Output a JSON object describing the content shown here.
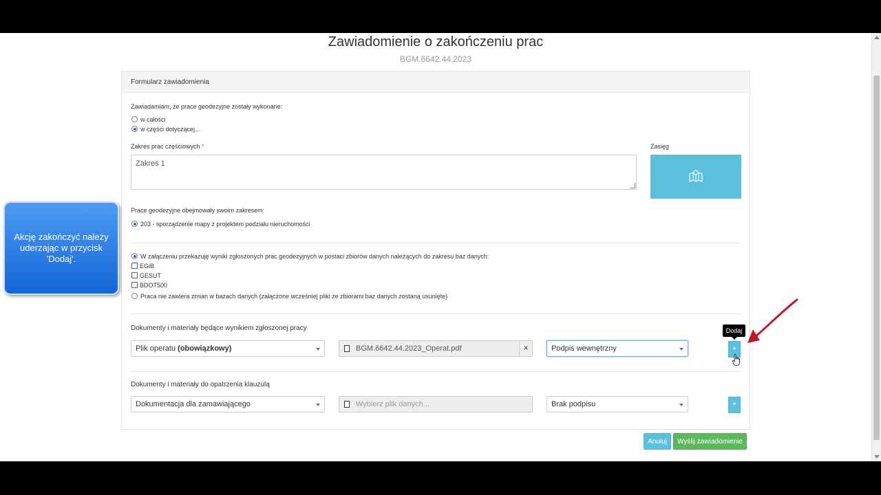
{
  "page": {
    "title": "Zawiadomienie o zakończeniu prac",
    "subtitle": "BGM.6642.44.2023"
  },
  "panel": {
    "heading": "Formularz zawiadomienia",
    "completion_question": "Zawiadamiam, że prace geodezyjne zostały wykonane:",
    "completion_options": [
      {
        "label": "w całości",
        "selected": false
      },
      {
        "label": "w części dotyczącej...",
        "selected": true
      }
    ],
    "partial_scope_label": "Zakres prac częściowych",
    "required_mark": "*",
    "partial_scope_value": "Zakres 1",
    "range_label": "Zasięg",
    "range_icon": "map-icon",
    "works_scope_label": "Prace geodezyjne obejmowały swoim zakresem:",
    "works_scope_option": "203 - sporządzenie mapy z projektem podziału nieruchomości",
    "results_option": "W załączeniu przekazuję wyniki zgłoszonych prac geodezyjnych w postaci zbiorów danych należących do zakresu baz danych:",
    "databases": [
      "EGiB",
      "GESUT",
      "BDOT500"
    ],
    "no_changes_option": "Praca nie zawiera zmian w bazach danych (załączone wcześniej pliki ze zbiorami baz danych zostaną usunięte)",
    "docs_result_label": "Dokumenty i materiały będące wynikiem zgłoszonej pracy",
    "docs_result_row": {
      "type_prefix": "Plik operatu ",
      "type_bold": "(obowiązkowy)",
      "file_name": "BGM.6642.44.2023_Operat.pdf",
      "clear_label": "×",
      "signature": "Podpis wewnętrzny",
      "add_label": "+"
    },
    "docs_clause_label": "Dokumenty i materiały do opatrzenia klauzulą",
    "docs_clause_row": {
      "type": "Dokumentacja dla zamawiającego",
      "file_placeholder": "Wybierz plik danych...",
      "signature": "Brak podpisu",
      "add_label": "+"
    }
  },
  "tooltip": "Dodaj",
  "buttons": {
    "cancel": "Anuluj",
    "send": "Wyślij zawiadomienie"
  },
  "callout": "Akcję zakończyć należy uderzając w przycisk 'Dodaj'.",
  "colors": {
    "info": "#5bc0de",
    "success": "#5cb85c",
    "arrow": "#c0182a"
  }
}
